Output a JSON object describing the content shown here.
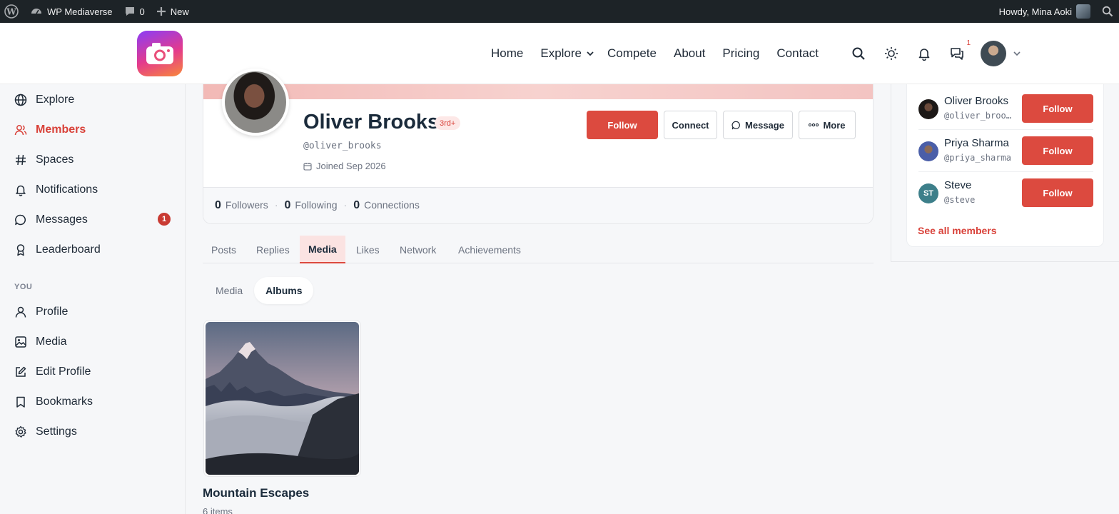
{
  "adminbar": {
    "site_name": "WP Mediaverse",
    "comments_count": "0",
    "new_label": "New",
    "howdy": "Howdy, Mina Aoki"
  },
  "nav": {
    "items": [
      "Home",
      "Explore",
      "Compete",
      "About",
      "Pricing",
      "Contact"
    ],
    "messages_count": "1"
  },
  "sidebar": {
    "items": [
      "Explore",
      "Members",
      "Spaces",
      "Notifications",
      "Messages",
      "Leaderboard"
    ],
    "messages_badge": "1",
    "you_section": "YOU",
    "you_items": [
      "Profile",
      "Media",
      "Edit Profile",
      "Bookmarks",
      "Settings"
    ]
  },
  "profile": {
    "name": "Oliver Brooks",
    "tag": "3rd+",
    "handle": "@oliver_brooks",
    "joined": "Joined Sep 2026",
    "buttons": {
      "follow": "Follow",
      "connect": "Connect",
      "message": "Message",
      "more": "More"
    },
    "stats": [
      {
        "num": "0",
        "label": "Followers"
      },
      {
        "num": "0",
        "label": "Following"
      },
      {
        "num": "0",
        "label": "Connections"
      }
    ]
  },
  "tabs": [
    "Posts",
    "Replies",
    "Media",
    "Likes",
    "Network",
    "Achievements"
  ],
  "subtabs": [
    "Media",
    "Albums"
  ],
  "album": {
    "title": "Mountain Escapes",
    "count": "6 items"
  },
  "members": {
    "list": [
      {
        "name": "Oliver Brooks",
        "handle": "@oliver_brooks",
        "button": "Follow"
      },
      {
        "name": "Priya Sharma",
        "handle": "@priya_sharma",
        "button": "Follow"
      },
      {
        "name": "Steve",
        "handle": "@steve",
        "initials": "ST",
        "button": "Follow"
      }
    ],
    "see_all": "See all members"
  },
  "colors": {
    "accent": "#dc4a3f",
    "adminbar": "#1d2327"
  }
}
